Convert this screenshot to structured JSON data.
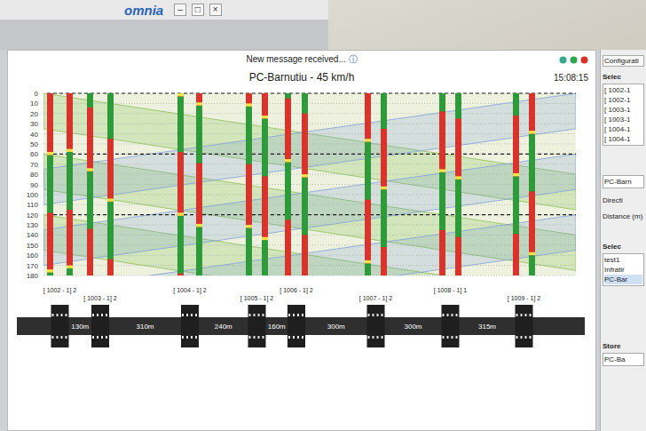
{
  "taskbar": {
    "logo": "omnia",
    "controls": [
      "–",
      "□",
      "×"
    ]
  },
  "notification": {
    "text": "New message received...",
    "icon": "ⓘ"
  },
  "status_icons": [
    {
      "color": "#3aa88a"
    },
    {
      "color": "#2fa84f"
    },
    {
      "color": "#d8322b"
    }
  ],
  "chart": {
    "title": "PC-Barnutiu - 45 km/h",
    "time": "15:08:15",
    "y_ticks": [
      "0",
      "10",
      "20",
      "30",
      "40",
      "50",
      "60",
      "70",
      "80",
      "90",
      "100",
      "110",
      "120",
      "130",
      "140",
      "150",
      "160",
      "170",
      "180"
    ],
    "cycle_marks": [
      0,
      60,
      120
    ],
    "intersections": [
      {
        "id": "[ 1002 - 1] 2",
        "bars": [
          {
            "green": [
              [
                61,
                118
              ],
              [
                177,
                180
              ]
            ],
            "yellow": [
              [
                58,
                61
              ],
              [
                174,
                177
              ]
            ]
          },
          {
            "green": [
              [
                58,
                115
              ],
              [
                173,
                180
              ]
            ],
            "yellow": [
              [
                55,
                58
              ],
              [
                170,
                173
              ]
            ]
          }
        ]
      },
      {
        "id": "[ 1003 - 1] 2",
        "bars": [
          {
            "green": [
              [
                0,
                14
              ],
              [
                77,
                134
              ]
            ],
            "yellow": [
              [
                74,
                77
              ]
            ]
          },
          {
            "green": [
              [
                0,
                45
              ],
              [
                107,
                164
              ]
            ],
            "yellow": [
              [
                104,
                107
              ]
            ]
          }
        ]
      },
      {
        "id": "[ 1004 - 1] 2",
        "bars": [
          {
            "green": [
              [
                3,
                58
              ],
              [
                121,
                178
              ]
            ],
            "yellow": [
              [
                0,
                3
              ],
              [
                118,
                121
              ]
            ]
          },
          {
            "green": [
              [
                12,
                69
              ],
              [
                132,
                180
              ]
            ],
            "yellow": [
              [
                9,
                12
              ],
              [
                129,
                132
              ]
            ]
          }
        ]
      },
      {
        "id": "[ 1005 - 1] 2",
        "bars": [
          {
            "green": [
              [
                13,
                70
              ],
              [
                133,
                180
              ]
            ],
            "yellow": [
              [
                10,
                13
              ],
              [
                130,
                133
              ]
            ]
          },
          {
            "green": [
              [
                25,
                82
              ],
              [
                145,
                180
              ]
            ],
            "yellow": [
              [
                22,
                25
              ],
              [
                142,
                145
              ]
            ]
          }
        ]
      },
      {
        "id": "[ 1006 - 1] 2",
        "bars": [
          {
            "green": [
              [
                0,
                5
              ],
              [
                68,
                125
              ]
            ],
            "yellow": [
              [
                65,
                68
              ]
            ]
          },
          {
            "green": [
              [
                0,
                20
              ],
              [
                83,
                140
              ]
            ],
            "yellow": [
              [
                80,
                83
              ]
            ]
          }
        ]
      },
      {
        "id": "[ 1007 - 1] 2",
        "bars": [
          {
            "green": [
              [
                48,
                105
              ],
              [
                168,
                180
              ]
            ],
            "yellow": [
              [
                45,
                48
              ],
              [
                165,
                168
              ]
            ]
          },
          {
            "green": [
              [
                0,
                35
              ],
              [
                95,
                152
              ]
            ],
            "yellow": [
              [
                92,
                95
              ]
            ]
          }
        ]
      },
      {
        "id": "[ 1008 - 1] 1",
        "bars": [
          {
            "green": [
              [
                0,
                18
              ],
              [
                78,
                135
              ]
            ],
            "yellow": [
              [
                75,
                78
              ]
            ]
          },
          {
            "green": [
              [
                0,
                25
              ],
              [
                85,
                142
              ]
            ],
            "yellow": [
              [
                82,
                85
              ]
            ]
          }
        ]
      },
      {
        "id": "[ 1009 - 1] 2",
        "bars": [
          {
            "green": [
              [
                0,
                22
              ],
              [
                82,
                139
              ]
            ],
            "yellow": [
              [
                79,
                82
              ]
            ]
          },
          {
            "green": [
              [
                40,
                97
              ],
              [
                160,
                180
              ]
            ],
            "yellow": [
              [
                37,
                40
              ],
              [
                157,
                160
              ]
            ]
          }
        ]
      }
    ],
    "bands": [
      {
        "direction": "east",
        "t_start": 0,
        "t_end": 80,
        "width": 35
      },
      {
        "direction": "east",
        "t_start": 60,
        "t_end": 140,
        "width": 35
      },
      {
        "direction": "east",
        "t_start": 120,
        "t_end": 200,
        "width": 35
      },
      {
        "direction": "west",
        "t_start": 75,
        "t_end": 0,
        "width": 35
      },
      {
        "direction": "west",
        "t_start": 135,
        "t_end": 60,
        "width": 35
      },
      {
        "direction": "west",
        "t_start": 195,
        "t_end": 120,
        "width": 35
      }
    ]
  },
  "road": {
    "gaps": [
      "130m",
      "310m",
      "240m",
      "160m",
      "300m",
      "300m",
      "315m"
    ]
  },
  "side_panel": {
    "tab": "Configurati",
    "select_heading": "Selec",
    "items": [
      "[ 1002-1",
      "[ 1002-1",
      "[ 1003-1",
      "[ 1003-1",
      "[ 1004-1",
      "[ 1004-1"
    ],
    "route_field": "PC-Barn",
    "direction_label": "Directi",
    "distance_label": "Distance (m)",
    "select2_heading": "Selec",
    "list2": [
      {
        "label": "test1",
        "selected": false
      },
      {
        "label": "Infratir",
        "selected": false
      },
      {
        "label": "PC-Bar",
        "selected": true
      }
    ],
    "store_heading": "Store",
    "store_item": "PC-Ba"
  }
}
